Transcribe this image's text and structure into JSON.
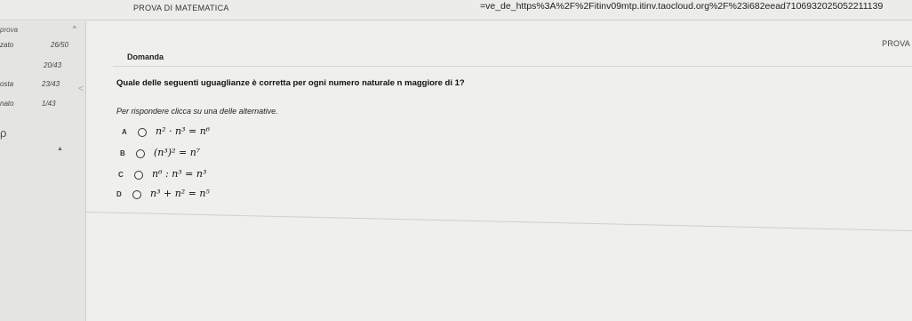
{
  "header": {
    "exam_title": "PROVA DI MATEMATICA",
    "url": "=ve_de_https%3A%2F%2Fitinv09mtp.itinv.taocloud.org%2F%23i682eead7106932025052211139"
  },
  "sidebar": {
    "heading": "prova",
    "chevron": "^",
    "rows": [
      {
        "label": "zato",
        "value": "26/50"
      },
      {
        "label": "",
        "value": "20/43"
      },
      {
        "label": "osta",
        "value": "23/43"
      },
      {
        "label": "nato",
        "value": "1/43"
      }
    ],
    "back_arrow": "<",
    "search_glyph": "ρ",
    "triangle_glyph": "▲"
  },
  "main": {
    "prova_label": "PROVA",
    "section_title": "Domanda",
    "question": "Quale delle seguenti uguaglianze è corretta per ogni numero naturale n maggiore di 1?",
    "instruction": "Per rispondere clicca su una delle alternative.",
    "options": [
      {
        "letter": "A",
        "text": "n² · n³ = n⁶"
      },
      {
        "letter": "B",
        "text": "(n³)² = n⁷"
      },
      {
        "letter": "C",
        "text": "n⁶ : n³ = n³"
      },
      {
        "letter": "D",
        "text": "n³ + n² = n⁵"
      }
    ]
  }
}
